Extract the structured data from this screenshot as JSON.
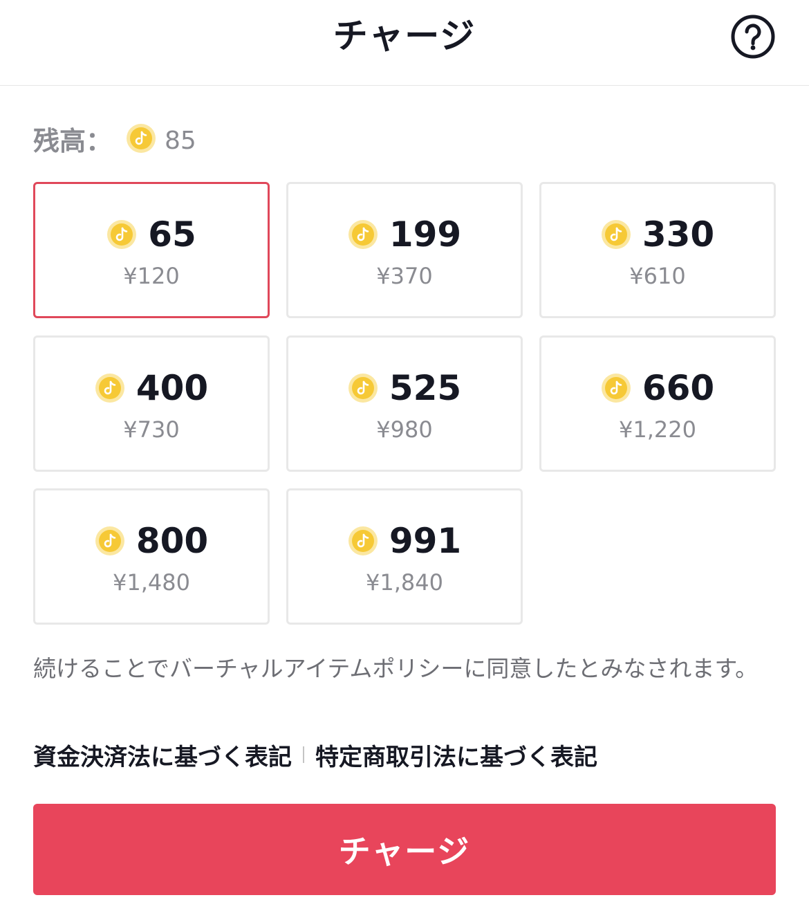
{
  "header": {
    "title": "チャージ"
  },
  "balance": {
    "label": "残高：",
    "value": "85"
  },
  "packages": [
    {
      "coins": "65",
      "price": "¥120",
      "selected": true
    },
    {
      "coins": "199",
      "price": "¥370",
      "selected": false
    },
    {
      "coins": "330",
      "price": "¥610",
      "selected": false
    },
    {
      "coins": "400",
      "price": "¥730",
      "selected": false
    },
    {
      "coins": "525",
      "price": "¥980",
      "selected": false
    },
    {
      "coins": "660",
      "price": "¥1,220",
      "selected": false
    },
    {
      "coins": "800",
      "price": "¥1,480",
      "selected": false
    },
    {
      "coins": "991",
      "price": "¥1,840",
      "selected": false
    }
  ],
  "policy_text": "続けることでバーチャルアイテムポリシーに同意したとみなされます。",
  "links": {
    "payment_act": "資金決済法に基づく表記",
    "commercial_act": "特定商取引法に基づく表記"
  },
  "charge_button": {
    "label": "チャージ"
  },
  "icons": {
    "coin": "coin-icon",
    "help": "help-icon"
  },
  "colors": {
    "accent": "#e8455b",
    "selected_border": "#e0485a",
    "coin_gold": "#f6c936",
    "muted_text": "#8a8b91"
  }
}
